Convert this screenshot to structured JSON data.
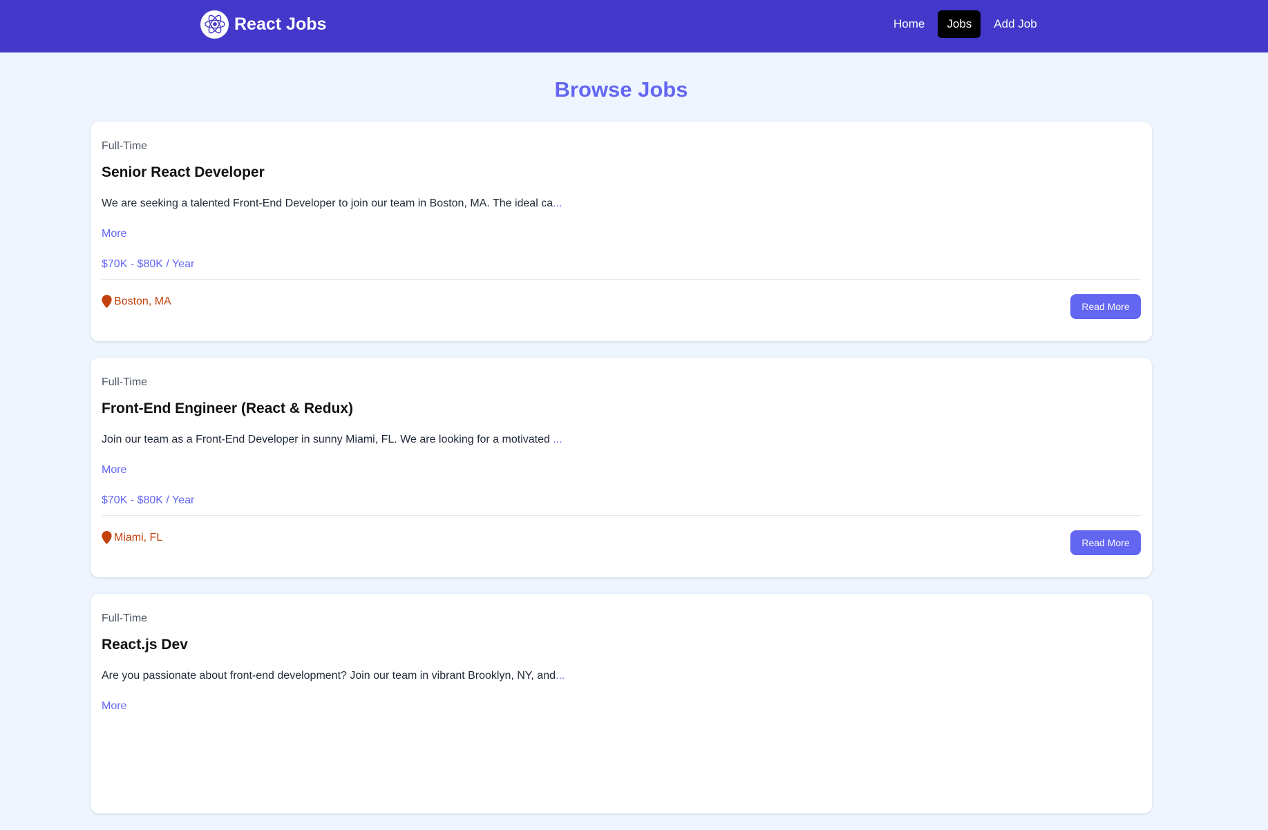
{
  "header": {
    "brand": "React Jobs",
    "nav": [
      {
        "label": "Home",
        "active": false
      },
      {
        "label": "Jobs",
        "active": true
      },
      {
        "label": "Add Job",
        "active": false
      }
    ]
  },
  "page": {
    "title": "Browse Jobs"
  },
  "jobs": [
    {
      "type": "Full-Time",
      "title": "Senior React Developer",
      "description": "We are seeking a talented Front-End Developer to join our team in Boston, MA. The ideal ca",
      "ellipsis": "...",
      "more_label": "More",
      "salary": "$70K - $80K / Year",
      "location": "Boston, MA",
      "button_label": "Read More"
    },
    {
      "type": "Full-Time",
      "title": "Front-End Engineer (React & Redux)",
      "description": "Join our team as a Front-End Developer in sunny Miami, FL. We are looking for a motivated ",
      "ellipsis": "...",
      "more_label": "More",
      "salary": "$70K - $80K / Year",
      "location": "Miami, FL",
      "button_label": "Read More"
    },
    {
      "type": "Full-Time",
      "title": "React.js Dev",
      "description": "Are you passionate about front-end development? Join our team in vibrant Brooklyn, NY, and",
      "ellipsis": "...",
      "more_label": "More",
      "salary": "",
      "location": "",
      "button_label": ""
    }
  ],
  "colors": {
    "navbar": "#4338ca",
    "accent": "#6366f1",
    "location": "#c2410c",
    "background": "#eef5ff"
  }
}
